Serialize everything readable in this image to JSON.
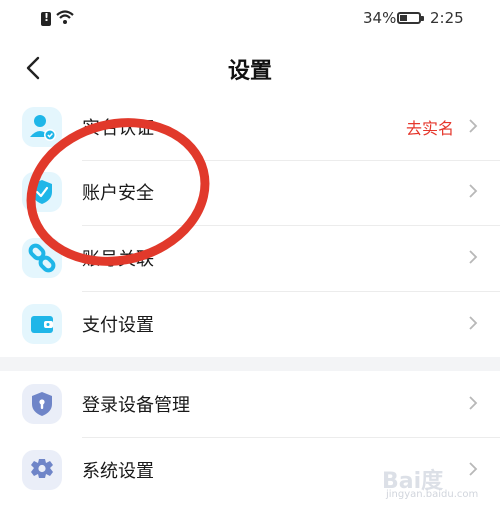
{
  "status_bar": {
    "battery_percent": "34%",
    "time": "2:25"
  },
  "header": {
    "title": "设置"
  },
  "settings": {
    "items": [
      {
        "label": "实名认证",
        "right_text": "去实名",
        "icon": "user-verify-icon",
        "icon_color": "#1fb6e8"
      },
      {
        "label": "账户安全",
        "right_text": "",
        "icon": "shield-check-icon",
        "icon_color": "#1fb6e8"
      },
      {
        "label": "账号关联",
        "right_text": "",
        "icon": "link-icon",
        "icon_color": "#1fb6e8"
      },
      {
        "label": "支付设置",
        "right_text": "",
        "icon": "wallet-icon",
        "icon_color": "#1fb6e8"
      },
      {
        "label": "登录设备管理",
        "right_text": "",
        "icon": "device-shield-icon",
        "icon_color": "#6f85c8"
      },
      {
        "label": "系统设置",
        "right_text": "",
        "icon": "gear-icon",
        "icon_color": "#6f85c8"
      }
    ]
  },
  "colors": {
    "accent_red": "#e5362b",
    "annotation_red": "#e1392b",
    "icon_blue": "#1fb6e8",
    "icon_slate": "#6f85c8"
  },
  "watermark": {
    "main": "Bai度",
    "sub": "jingyan.baidu.com"
  }
}
